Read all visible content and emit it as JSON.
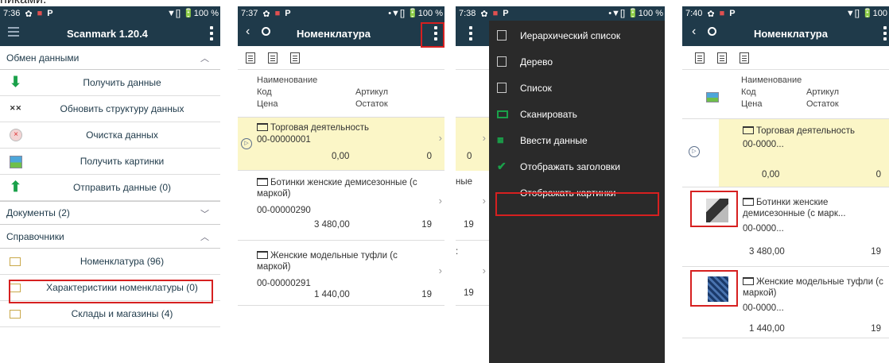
{
  "header_text": "никами.",
  "colors": {
    "appbar": "#1f3a4a",
    "highlight": "#fbf6c7",
    "accent_green": "#1aa14a",
    "red_box": "#d62020",
    "menu_bg": "#2a2a2a"
  },
  "s1": {
    "time": "7:36",
    "status_right": "▼[] 🔋100 %",
    "title": "Scanmark 1.20.4",
    "sec1": "Обмен данными",
    "items": [
      "Получить данные",
      "Обновить структуру данных",
      "Очистка данных",
      "Получить картинки",
      "Отправить данные (0)"
    ],
    "sec2": "Документы (2)",
    "sec3": "Справочники",
    "ref_items": [
      "Номенклатура (96)",
      "Характеристики номенклатуры (0)",
      "Склады и магазины (4)"
    ]
  },
  "s2": {
    "time": "7:37",
    "status_right": "•▼[] 🔋100 %",
    "title": "Номенклатура",
    "h_name": "Наименование",
    "h_code": "Код",
    "h_art": "Артикул",
    "h_price": "Цена",
    "h_stock": "Остаток",
    "rows": [
      {
        "name": "Торговая деятельность",
        "code": "00-00000001",
        "price": "0,00",
        "stock": "0"
      },
      {
        "name": "Ботинки женские демисезонные (с маркой)",
        "code": "00-00000290",
        "price": "3 480,00",
        "stock": "19"
      },
      {
        "name": "Женские модельные туфли (с маркой)",
        "code": "00-00000291",
        "price": "1 440,00",
        "stock": "19"
      }
    ]
  },
  "s3": {
    "time": "7:38",
    "status_right": "•▼[] 🔋100 %",
    "bg_vals": [
      "0",
      "ные",
      "19",
      ":",
      "19"
    ],
    "menu": [
      "Иерархический список",
      "Дерево",
      "Список",
      "Сканировать",
      "Ввести данные",
      "Отображать заголовки",
      "Отображать картинки"
    ]
  },
  "s4": {
    "time": "7:40",
    "status_right": "▼[] 🔋100",
    "title": "Номенклатура",
    "h_name": "Наименование",
    "h_code": "Код",
    "h_art": "Артикул",
    "h_price": "Цена",
    "h_stock": "Остаток",
    "rows": [
      {
        "name": "Торговая деятельность",
        "code": "00-0000...",
        "price": "0,00",
        "stock": "0"
      },
      {
        "name": "Ботинки женские демисезонные (с марк...",
        "code": "00-0000...",
        "price": "3 480,00",
        "stock": "19"
      },
      {
        "name": "Женские модельные туфли (с маркой)",
        "code": "00-0000...",
        "price": "1 440,00",
        "stock": "19"
      }
    ]
  }
}
